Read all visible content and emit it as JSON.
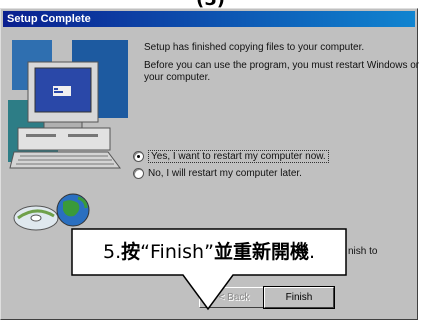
{
  "header_cut": "(5)",
  "window": {
    "title": "Setup Complete"
  },
  "content": {
    "line1": "Setup has finished copying files to your computer.",
    "line2a": "Before you can use the program, you must restart Windows or",
    "line2b": "your computer.",
    "options": [
      {
        "label": "Yes, I want to restart my computer now.",
        "selected": true
      },
      {
        "label": "No, I will restart my computer later.",
        "selected": false
      }
    ],
    "obscured_text": "nish to"
  },
  "buttons": {
    "back": "< Back",
    "finish": "Finish"
  },
  "callout": {
    "prefix": "5.",
    "verb": "按",
    "quoted": "“Finish”",
    "action": "並重新開機",
    "suffix": "."
  },
  "colors": {
    "title_start": "#0a1f8f",
    "title_end": "#1084d0",
    "dialog": "#c0c0c0"
  }
}
